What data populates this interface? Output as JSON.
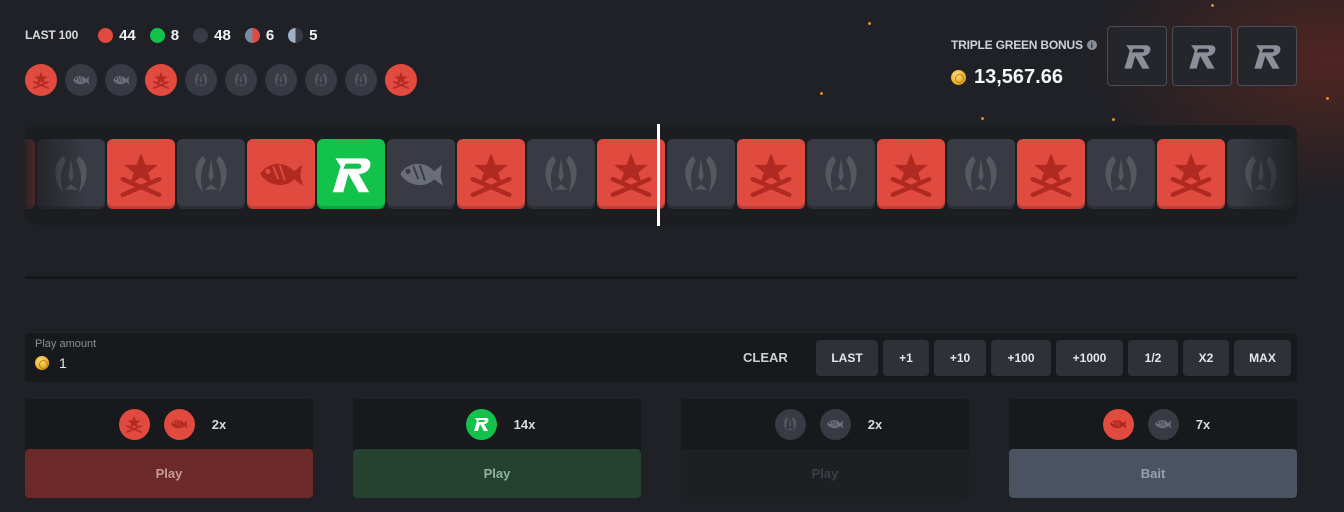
{
  "stats": {
    "last_label": "LAST 100",
    "counts": [
      {
        "color": "red",
        "value": "44"
      },
      {
        "color": "green",
        "value": "8"
      },
      {
        "color": "dark",
        "value": "48"
      },
      {
        "color": "halfred",
        "value": "6"
      },
      {
        "color": "halfdark",
        "value": "5"
      }
    ]
  },
  "history": [
    "red-ct",
    "dark-fish",
    "dark-fish",
    "red-ct",
    "dark-t",
    "dark-t",
    "dark-t",
    "dark-t",
    "dark-t",
    "red-ct"
  ],
  "bonus": {
    "title": "TRIPLE GREEN BONUS",
    "info_icon": "i",
    "amount": "13,567.66",
    "slots": [
      "r-logo-icon",
      "r-logo-icon",
      "r-logo-icon"
    ]
  },
  "roller": {
    "tiles": [
      "red-ct",
      "dark-t",
      "red-ct",
      "dark-t",
      "red-fish",
      "green-r",
      "dark-fish",
      "red-ct",
      "dark-t",
      "red-ct",
      "dark-t",
      "red-ct",
      "dark-t",
      "red-ct",
      "dark-t",
      "red-ct",
      "dark-t",
      "red-ct",
      "dark-t"
    ]
  },
  "play_amount": {
    "label": "Play amount",
    "value": "1",
    "clear_label": "CLEAR",
    "buttons": [
      "LAST",
      "+1",
      "+10",
      "+100",
      "+1000",
      "1/2",
      "X2",
      "MAX"
    ]
  },
  "panels": [
    {
      "icons": [
        "red-ct",
        "red-fish"
      ],
      "multiplier": "2x",
      "button": "Play",
      "style": "red"
    },
    {
      "icons": [
        "green-r"
      ],
      "multiplier": "14x",
      "button": "Play",
      "style": "green"
    },
    {
      "icons": [
        "dark-t",
        "dark-fish"
      ],
      "multiplier": "2x",
      "button": "Play",
      "style": "dark"
    },
    {
      "icons": [
        "red-fish",
        "dark-fish"
      ],
      "multiplier": "7x",
      "button": "Bait",
      "style": "bait"
    }
  ],
  "colors": {
    "red": "#e04a3f",
    "green": "#13c24a",
    "dark": "#383b43",
    "background": "#1f2126"
  }
}
